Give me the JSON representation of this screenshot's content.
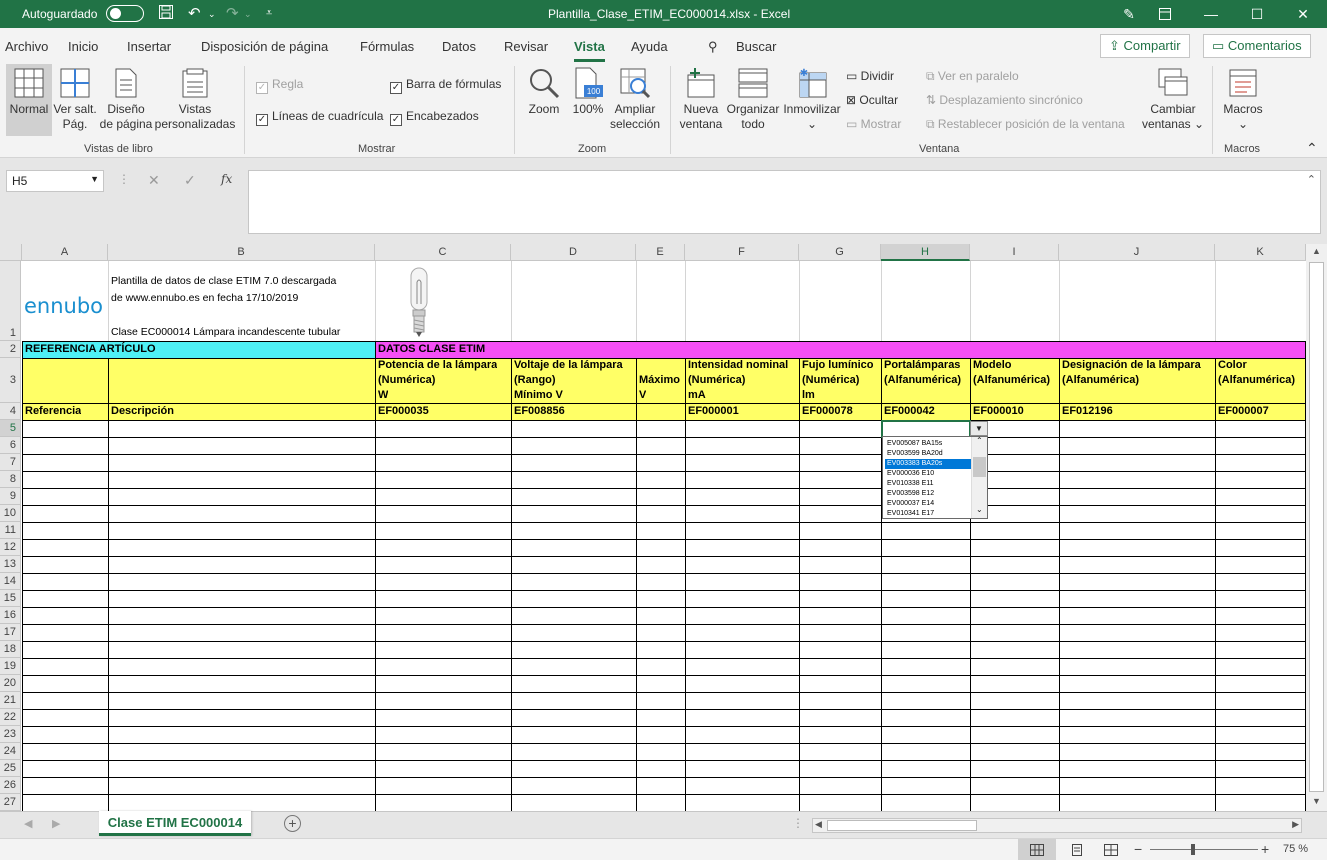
{
  "titlebar": {
    "autosave": "Autoguardado",
    "title": "Plantilla_Clase_ETIM_EC000014.xlsx  -  Excel"
  },
  "menu": {
    "tabs": [
      "Archivo",
      "Inicio",
      "Insertar",
      "Disposición de página",
      "Fórmulas",
      "Datos",
      "Revisar",
      "Vista",
      "Ayuda"
    ],
    "active": "Vista",
    "search": "Buscar",
    "share": "Compartir",
    "comments": "Comentarios"
  },
  "ribbon": {
    "normal": "Normal",
    "ver_salt_1": "Ver salt.",
    "ver_salt_2": "Pág.",
    "diseno_1": "Diseño",
    "diseno_2": "de página",
    "vistas_1": "Vistas",
    "vistas_2": "personalizadas",
    "group_vistas": "Vistas de libro",
    "regla": "Regla",
    "barra_formulas": "Barra de fórmulas",
    "lineas": "Líneas de cuadrícula",
    "encabezados": "Encabezados",
    "group_mostrar": "Mostrar",
    "zoom": "Zoom",
    "zoom100": "100%",
    "ampliar_1": "Ampliar",
    "ampliar_2": "selección",
    "group_zoom": "Zoom",
    "nueva_1": "Nueva",
    "nueva_2": "ventana",
    "organizar_1": "Organizar",
    "organizar_2": "todo",
    "inmovilizar": "Inmovilizar",
    "dividir": "Dividir",
    "ocultar": "Ocultar",
    "mostrar": "Mostrar",
    "ver_paralelo": "Ver en paralelo",
    "desplazamiento": "Desplazamiento sincrónico",
    "restablecer": "Restablecer posición de la ventana",
    "cambiar_1": "Cambiar",
    "cambiar_2": "ventanas",
    "group_ventana": "Ventana",
    "macros": "Macros",
    "group_macros": "Macros"
  },
  "formula_bar": {
    "name_box": "H5",
    "fx": "fx",
    "content": ""
  },
  "grid": {
    "columns": [
      "A",
      "B",
      "C",
      "D",
      "E",
      "F",
      "G",
      "H",
      "I",
      "J",
      "K"
    ],
    "active_column": "H",
    "rows": [
      "1",
      "2",
      "3",
      "4",
      "5",
      "6",
      "7",
      "8",
      "9",
      "10",
      "11",
      "12",
      "13",
      "14",
      "15",
      "16",
      "17",
      "18",
      "19",
      "20",
      "21",
      "22",
      "23",
      "24",
      "25",
      "26",
      "27"
    ],
    "active_row": "5",
    "logo": "ennubo",
    "info_line1": "Plantilla de datos de clase ETIM 7.0 descargada",
    "info_line2": "de www.ennubo.es en fecha 17/10/2019",
    "info_line3": "Clase EC000014 Lámpara incandescente tubular",
    "ref_articulo": "REFERENCIA ARTÍCULO",
    "datos_clase": "DATOS CLASE ETIM",
    "headers": {
      "C1": "Potencia de la lámpara",
      "C2": "(Numérica)",
      "C3": "W",
      "D1": "Voltaje de la lámpara",
      "D2": "(Rango)",
      "D3": "Mínimo V",
      "E2": "Máximo",
      "E3": "V",
      "F1": "Intensidad nominal",
      "F2": "(Numérica)",
      "F3": "mA",
      "G1": "Fujo lumínico",
      "G2": "(Numérica)",
      "G3": "lm",
      "H1": "Portalámparas",
      "H2": "(Alfanumérica)",
      "I1": "Modelo",
      "I2": "(Alfanumérica)",
      "J1": "Designación de la lámpara",
      "J2": "(Alfanumérica)",
      "K1": "Color",
      "K2": "(Alfanumérica)"
    },
    "row4": {
      "A": "Referencia",
      "B": "Descripción",
      "C": "EF000035",
      "D": "EF008856",
      "F": "EF000001",
      "G": "EF000078",
      "H": "EF000042",
      "I": "EF000010",
      "J": "EF012196",
      "K": "EF000007"
    }
  },
  "dropdown": {
    "items": [
      "EV005087 BA15s",
      "EV003599 BA20d",
      "EV003383 BA20s",
      "EV000036 E10",
      "EV010338 E11",
      "EV003598 E12",
      "EV000037 E14",
      "EV010341 E17"
    ],
    "selected_index": 2
  },
  "sheets": {
    "active": "Clase ETIM EC000014"
  },
  "status": {
    "zoom": "75 %"
  },
  "colors": {
    "excel_green": "#217346",
    "cyan": "#4ff0f5",
    "magenta": "#f54ff5",
    "yellow": "#ffff66"
  }
}
